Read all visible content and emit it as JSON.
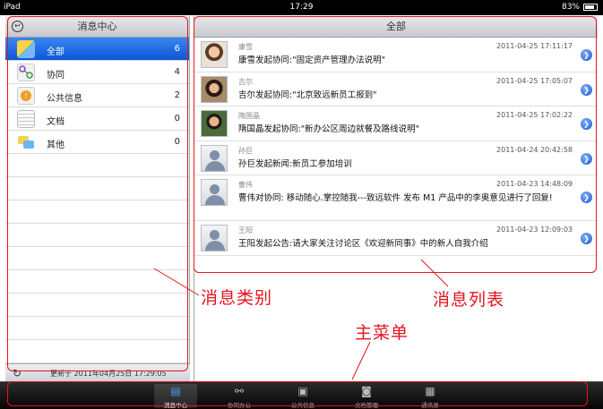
{
  "status": {
    "device": "iPad",
    "time": "17:29",
    "battery": "83%"
  },
  "left": {
    "title": "消息中心",
    "categories": [
      {
        "label": "全部",
        "count": "6"
      },
      {
        "label": "协同",
        "count": "4"
      },
      {
        "label": "公共信息",
        "count": "2"
      },
      {
        "label": "文档",
        "count": "0"
      },
      {
        "label": "其他",
        "count": "0"
      }
    ],
    "updated": "更新于 2011年04月25日 17:29:05"
  },
  "right": {
    "title": "全部",
    "messages": [
      {
        "sender": "康雪",
        "time": "2011-04-25 17:11:17",
        "text": "康雪发起协同:\"固定资产管理办法说明\""
      },
      {
        "sender": "吉尔",
        "time": "2011-04-25 17:05:07",
        "text": "吉尔发起协同:\"北京致远新员工报到\""
      },
      {
        "sender": "隋国晶",
        "time": "2011-04-25 17:02:22",
        "text": "隋国晶发起协同:\"新办公区周边就餐及路线说明\""
      },
      {
        "sender": "孙巨",
        "time": "2011-04-24 20:42:58",
        "text": "孙巨发起新闻:新员工参加培训"
      },
      {
        "sender": "曹伟",
        "time": "2011-04-23 14:48:09",
        "text": "曹伟对协同: 移动随心.掌控随我---致远软件 发布 M1 产品中的李奥意见进行了回复!"
      },
      {
        "sender": "王阳",
        "time": "2011-04-23 12:09:03",
        "text": "王阳发起公告:请大家关注讨论区《欢迎新同事》中的新人自我介绍"
      }
    ]
  },
  "tabbar": {
    "tabs": [
      {
        "label": "消息中心",
        "icon": "inbox-icon"
      },
      {
        "label": "协同办公",
        "icon": "workflow-icon"
      },
      {
        "label": "公共信息",
        "icon": "bulletin-icon"
      },
      {
        "label": "文档管理",
        "icon": "document-search-icon"
      },
      {
        "label": "通讯录",
        "icon": "contacts-icon"
      }
    ]
  },
  "annotations": {
    "left_label": "消息类别",
    "right_label": "消息列表",
    "menu_label": "主菜单"
  },
  "colors": {
    "annotation": "#e8121e",
    "selected_row": "#0d57d6",
    "active_tab_icon": "#3ea0ff"
  }
}
